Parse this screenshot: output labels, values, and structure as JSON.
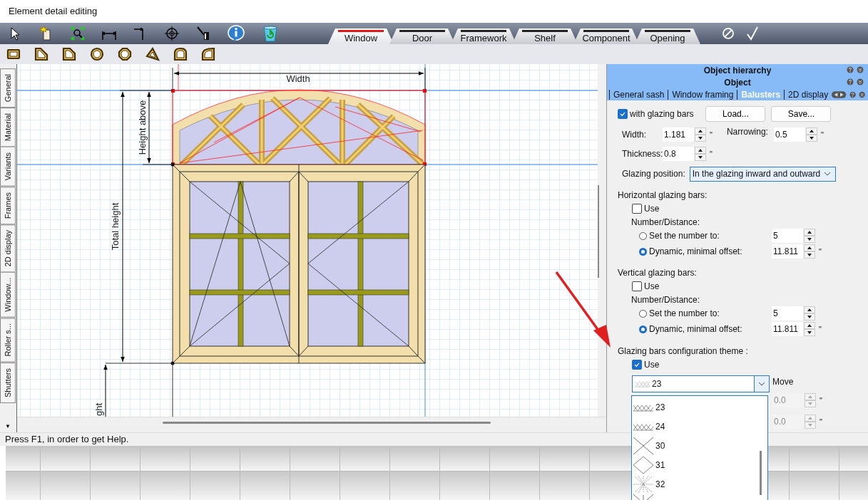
{
  "window": {
    "title": "Element detail editing"
  },
  "category_tabs": [
    {
      "label": "Window",
      "selected": true
    },
    {
      "label": "Door",
      "selected": false
    },
    {
      "label": "Framework",
      "selected": false
    },
    {
      "label": "Shelf",
      "selected": false
    },
    {
      "label": "Component",
      "selected": false
    },
    {
      "label": "Opening",
      "selected": false
    }
  ],
  "side_tabs": [
    {
      "label": "General"
    },
    {
      "label": "Material"
    },
    {
      "label": "Variants"
    },
    {
      "label": "Frames"
    },
    {
      "label": "2D display"
    },
    {
      "label": "Window..."
    },
    {
      "label": "Roller s..."
    },
    {
      "label": "Shutters"
    }
  ],
  "side_tabs_scroll": "▼",
  "canvas": {
    "width_label": "Width",
    "height_above_label": "Height  above",
    "total_height_label": "Total height",
    "cut_label": "ght"
  },
  "panel": {
    "headers": [
      {
        "title": "Object hierarchy"
      },
      {
        "title": "Object"
      }
    ],
    "tabs": [
      {
        "label": "General sash",
        "selected": false
      },
      {
        "label": "Window framing",
        "selected": false
      },
      {
        "label": "Balusters",
        "selected": true
      },
      {
        "label": "2D display",
        "selected": false
      }
    ],
    "glazing_bars": {
      "label": "with glazing bars",
      "checked": true
    },
    "buttons": [
      "Load...",
      "Save..."
    ],
    "width": {
      "label": "Width:",
      "value": "1.181",
      "unit": "\""
    },
    "narrowing": {
      "label": "Narrowing:",
      "value": "0.5",
      "unit": "\""
    },
    "thickness": {
      "label": "Thickness:",
      "value": "0.8",
      "unit": "\""
    },
    "glazing_position": {
      "label": "Glazing position:",
      "value": "In the glazing inward and outward"
    },
    "sections": [
      {
        "title": "Horizontal glazing bars:",
        "use": {
          "label": "Use",
          "checked": false
        },
        "subtitle": "Number/Distance:",
        "options": [
          {
            "label": "Set the number to:",
            "selected": false,
            "value": "5"
          },
          {
            "label": "Dynamic, minimal offset:",
            "selected": true,
            "value": "11.811",
            "unit": "\""
          }
        ]
      },
      {
        "title": "Vertical glazing bars:",
        "use": {
          "label": "Use",
          "checked": false
        },
        "subtitle": "Number/Distance:",
        "options": [
          {
            "label": "Set the number to:",
            "selected": false,
            "value": "5"
          },
          {
            "label": "Dynamic, minimal offset:",
            "selected": true,
            "value": "11.811",
            "unit": "\""
          }
        ]
      }
    ],
    "theme": {
      "title": "Glazing bars configuration theme :",
      "use": {
        "label": "Use",
        "checked": true
      },
      "value": "23",
      "move_label": "Move",
      "offsets": [
        {
          "value": "0.0",
          "unit": "\"",
          "disabled": true
        },
        {
          "value": "0.0",
          "unit": "\"",
          "disabled": true
        }
      ],
      "options": [
        {
          "kind": "lattice",
          "label": "23"
        },
        {
          "kind": "lattice",
          "label": "24"
        },
        {
          "kind": "cross",
          "label": "30"
        },
        {
          "kind": "diamond",
          "label": "31"
        },
        {
          "kind": "star",
          "label": "32"
        },
        {
          "kind": "cross-bar"
        }
      ]
    }
  },
  "status_bar": {
    "text": "Press F1, in order to get Help."
  }
}
